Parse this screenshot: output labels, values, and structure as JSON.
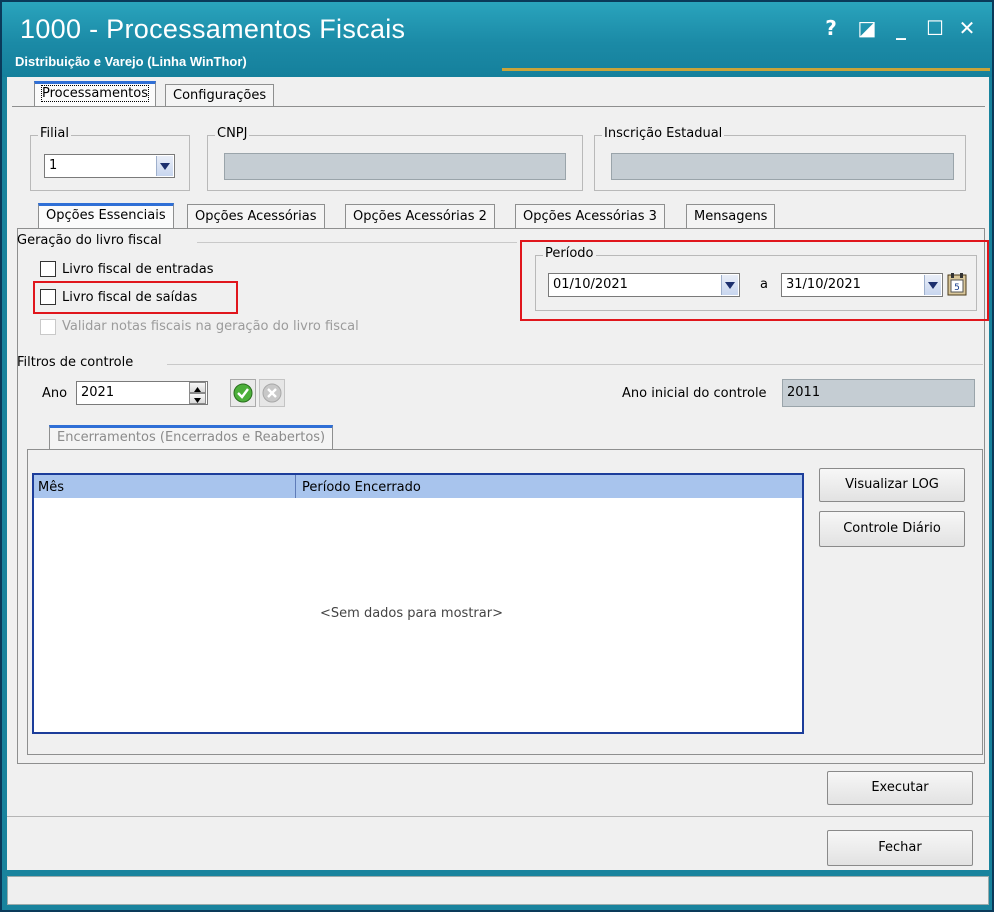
{
  "window": {
    "title": "1000 - Processamentos Fiscais",
    "subtitle": "Distribuição e Varejo (Linha WinThor)",
    "controls": [
      "?",
      "◪",
      "_",
      "☐",
      "✕"
    ]
  },
  "top_tabs": [
    {
      "label": "Processamentos",
      "active": true
    },
    {
      "label": "Configurações",
      "active": false
    }
  ],
  "header_fields": {
    "filial": {
      "label": "Filial",
      "value": "1"
    },
    "cnpj": {
      "label": "CNPJ",
      "value": ""
    },
    "inscricao": {
      "label": "Inscrição Estadual",
      "value": ""
    }
  },
  "inner_tabs": [
    {
      "label": "Opções Essenciais",
      "active": true
    },
    {
      "label": "Opções Acessórias",
      "active": false
    },
    {
      "label": "Opções Acessórias 2",
      "active": false
    },
    {
      "label": "Opções Acessórias 3",
      "active": false
    },
    {
      "label": "Mensagens",
      "active": false
    }
  ],
  "geracao": {
    "title": "Geração do livro fiscal",
    "checkboxes": [
      {
        "label": "Livro fiscal de entradas",
        "checked": false,
        "enabled": true
      },
      {
        "label": "Livro fiscal de saídas",
        "checked": false,
        "enabled": true
      },
      {
        "label": "Validar notas fiscais na geração do livro fiscal",
        "checked": false,
        "enabled": false
      }
    ]
  },
  "periodo": {
    "title": "Período",
    "start": "01/10/2021",
    "separator": "a",
    "end": "31/10/2021"
  },
  "filtros": {
    "title": "Filtros de controle",
    "ano_label": "Ano",
    "ano_value": "2021",
    "ano_inicial_label": "Ano inicial do controle",
    "ano_inicial_value": "2011"
  },
  "encerramentos": {
    "tab_label": "Encerramentos (Encerrados e Reabertos)",
    "columns": [
      "Mês",
      "Período Encerrado"
    ],
    "empty_text": "<Sem dados para mostrar>",
    "buttons": {
      "log": "Visualizar LOG",
      "diario": "Controle Diário"
    }
  },
  "actions": {
    "executar": "Executar",
    "fechar": "Fechar"
  },
  "colors": {
    "titlebar": "#1b8aa6",
    "highlight": "#e0161c",
    "grid_header": "#a8c4ed",
    "grid_border": "#1c3d9a"
  }
}
